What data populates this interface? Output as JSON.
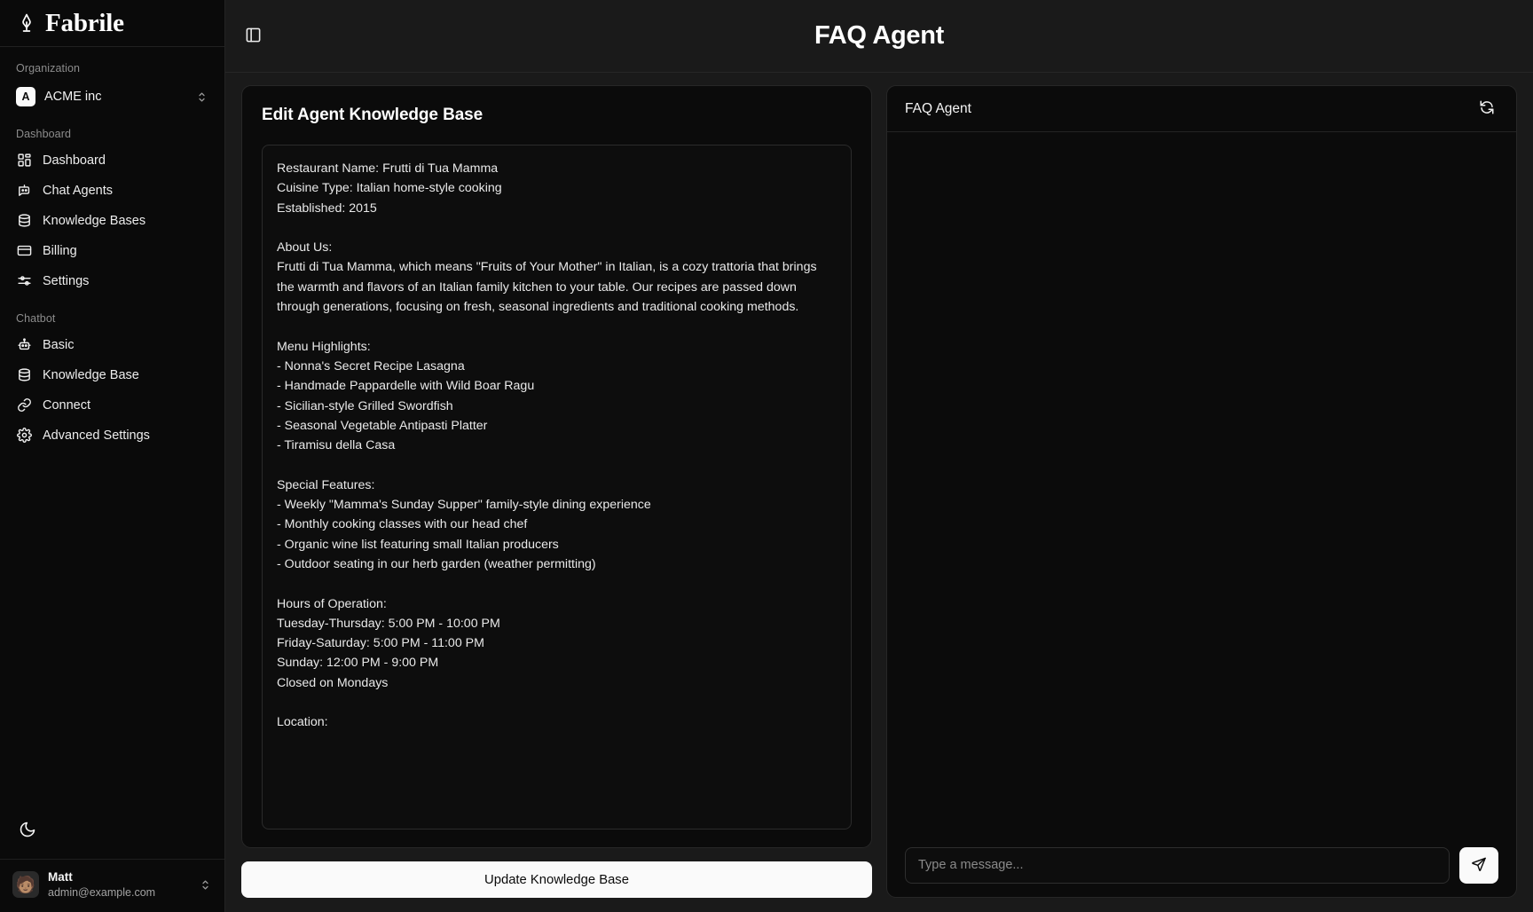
{
  "brand": {
    "name": "Fabrile",
    "logo_icon": "pen-nib-icon"
  },
  "sidebar": {
    "organization_label": "Organization",
    "organization": {
      "badge": "A",
      "name": "ACME inc",
      "chevron_icon": "chevron-up-down-icon"
    },
    "dashboard_label": "Dashboard",
    "dashboard_items": [
      {
        "label": "Dashboard",
        "icon": "layout-dashboard-icon"
      },
      {
        "label": "Chat Agents",
        "icon": "bot-message-icon"
      },
      {
        "label": "Knowledge Bases",
        "icon": "database-icon"
      },
      {
        "label": "Billing",
        "icon": "credit-card-icon"
      },
      {
        "label": "Settings",
        "icon": "sliders-icon"
      }
    ],
    "chatbot_label": "Chatbot",
    "chatbot_items": [
      {
        "label": "Basic",
        "icon": "bot-icon"
      },
      {
        "label": "Knowledge Base",
        "icon": "database-icon"
      },
      {
        "label": "Connect",
        "icon": "link-icon"
      },
      {
        "label": "Advanced Settings",
        "icon": "gear-icon"
      }
    ],
    "theme_toggle_icon": "moon-icon",
    "user": {
      "avatar": "🧑🏽",
      "name": "Matt",
      "email": "admin@example.com",
      "chevron_icon": "chevron-up-down-icon"
    }
  },
  "topbar": {
    "toggle_icon": "panel-left-icon",
    "title": "FAQ Agent"
  },
  "knowledge_panel": {
    "title": "Edit Agent Knowledge Base",
    "content": "Restaurant Name: Frutti di Tua Mamma\nCuisine Type: Italian home-style cooking\nEstablished: 2015\n\nAbout Us:\nFrutti di Tua Mamma, which means \"Fruits of Your Mother\" in Italian, is a cozy trattoria that brings the warmth and flavors of an Italian family kitchen to your table. Our recipes are passed down through generations, focusing on fresh, seasonal ingredients and traditional cooking methods.\n\nMenu Highlights:\n- Nonna's Secret Recipe Lasagna\n- Handmade Pappardelle with Wild Boar Ragu\n- Sicilian-style Grilled Swordfish\n- Seasonal Vegetable Antipasti Platter\n- Tiramisu della Casa\n\nSpecial Features:\n- Weekly \"Mamma's Sunday Supper\" family-style dining experience\n- Monthly cooking classes with our head chef\n- Organic wine list featuring small Italian producers\n- Outdoor seating in our herb garden (weather permitting)\n\nHours of Operation:\nTuesday-Thursday: 5:00 PM - 10:00 PM\nFriday-Saturday: 5:00 PM - 11:00 PM\nSunday: 12:00 PM - 9:00 PM\nClosed on Mondays\n\nLocation:",
    "update_button": "Update Knowledge Base"
  },
  "chat_panel": {
    "title": "FAQ Agent",
    "reset_icon": "refresh-icon",
    "messages": [],
    "input_placeholder": "Type a message...",
    "input_value": "",
    "send_icon": "send-icon"
  },
  "colors": {
    "page_bg": "#1a1a1a",
    "sidebar_bg": "#0a0a0a",
    "card_bg": "#0b0b0b",
    "accent": "#fafafa",
    "text_primary": "#ffffff",
    "text_muted": "#8c8c8c",
    "border": "#272727"
  }
}
